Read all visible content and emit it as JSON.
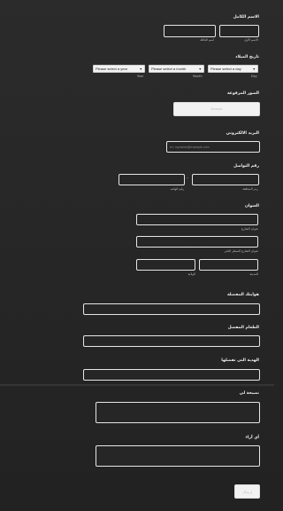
{
  "full_name": {
    "label": "الاسم الكامل",
    "first_sub": "الاسم الأول",
    "last_sub": "اسم العائلة"
  },
  "birth_date": {
    "label": "تاريخ الميلاد",
    "year_select": "Please select a year",
    "month_select": "Please select a month",
    "day_select": "Please select a day",
    "year_sub": "Year",
    "month_sub": "Month",
    "day_sub": "Day"
  },
  "uploads": {
    "label": "الصور المرفوعة",
    "button": "Browse"
  },
  "email": {
    "label": "البريد الالكتروني",
    "placeholder": "ex: myname@example.com"
  },
  "phone": {
    "label": "رقم التواصل",
    "dash": "-",
    "area_sub": "رمز المنطقة",
    "number_sub": "رقم الهاتف"
  },
  "address": {
    "label": "العنوان",
    "street_sub": "عنوان الشارع",
    "street2_sub": "عنوان الشارع السطر الثاني",
    "city_sub": "المدينة",
    "state_sub": "الولاية"
  },
  "q_hobby": {
    "label": "هوايتك المفضلة"
  },
  "q_food": {
    "label": "الطعام المفضل"
  },
  "q_gift": {
    "label": "الهدية التي تفضلها"
  },
  "q_advice": {
    "label": "نصيحة لي"
  },
  "q_opinion": {
    "label": "أي آراء"
  },
  "submit": {
    "label": "إرسال"
  }
}
